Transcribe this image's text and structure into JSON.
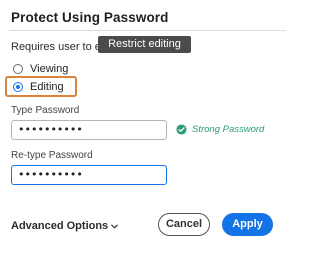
{
  "dialog": {
    "title": "Protect Using Password",
    "requires_label": "Requires user to enter",
    "tooltip": "Restrict editing"
  },
  "options": {
    "viewing": {
      "label": "Viewing",
      "checked": false
    },
    "editing": {
      "label": "Editing",
      "checked": true
    }
  },
  "fields": {
    "type_password": {
      "label": "Type Password",
      "value": "••••••••••"
    },
    "retype_password": {
      "label": "Re-type Password",
      "value": "••••••••••"
    }
  },
  "strength": {
    "text": "Strong Password",
    "color": "#2d9d78",
    "icon": "check-circle-icon"
  },
  "footer": {
    "advanced_label": "Advanced Options",
    "cancel_label": "Cancel",
    "apply_label": "Apply"
  },
  "colors": {
    "accent": "#1473e6",
    "highlight": "#d9843c",
    "tooltip_bg": "#4b4b4b"
  }
}
